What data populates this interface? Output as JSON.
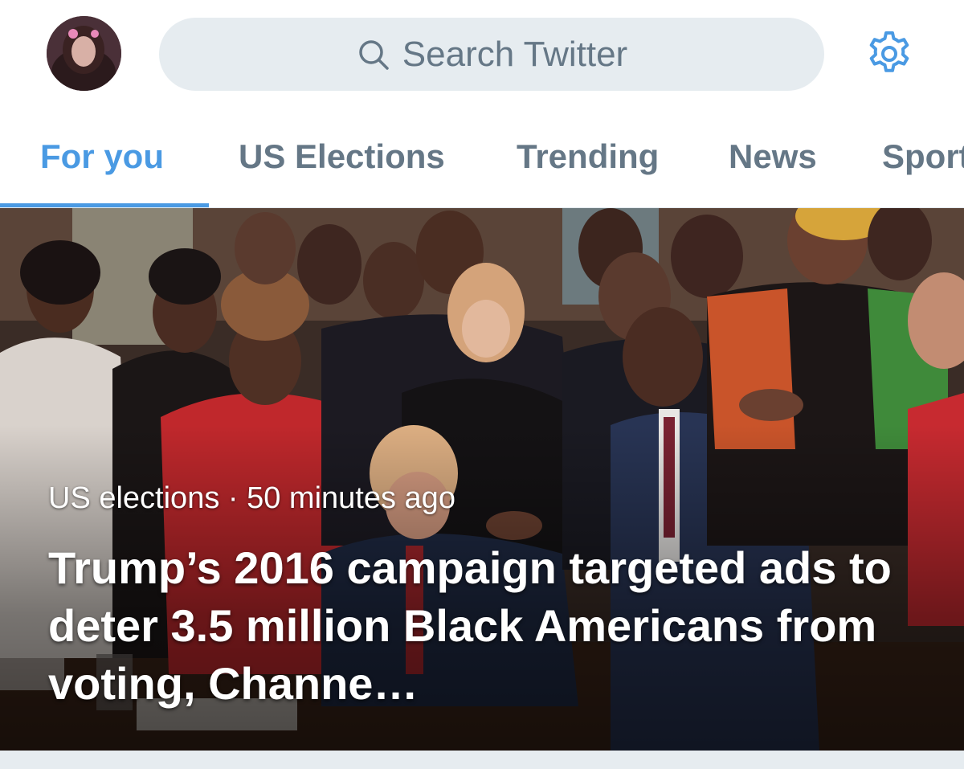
{
  "header": {
    "avatar_icon": "user-avatar",
    "search_placeholder": "Search Twitter",
    "search_icon": "search-icon",
    "settings_icon": "gear-icon"
  },
  "tabs": [
    {
      "label": "For you",
      "active": true
    },
    {
      "label": "US Elections",
      "active": false
    },
    {
      "label": "Trending",
      "active": false
    },
    {
      "label": "News",
      "active": false
    },
    {
      "label": "Sports",
      "active": false
    }
  ],
  "story": {
    "category": "US elections",
    "separator": "·",
    "time": "50 minutes ago",
    "headline": "Trump’s 2016 campaign targeted ads to deter 3.5 million Black Americans from voting, Channe…"
  },
  "colors": {
    "accent": "#4a9ae3",
    "muted_text": "#657786",
    "search_bg": "#e6ecf0"
  }
}
